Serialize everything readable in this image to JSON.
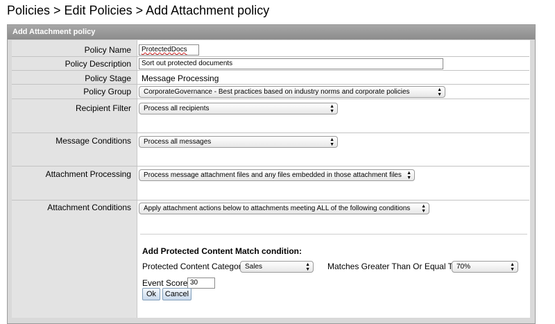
{
  "breadcrumb": "Policies > Edit Policies > Add Attachment policy",
  "panel": {
    "title": "Add Attachment policy"
  },
  "fields": {
    "policy_name": {
      "label": "Policy Name",
      "value": "ProtectedDocs"
    },
    "policy_description": {
      "label": "Policy Description",
      "value": "Sort out protected documents"
    },
    "policy_stage": {
      "label": "Policy Stage",
      "value": "Message Processing"
    },
    "policy_group": {
      "label": "Policy Group",
      "value": "CorporateGovernance - Best practices based on industry norms and corporate policies"
    },
    "recipient_filter": {
      "label": "Recipient Filter",
      "value": "Process all recipients"
    },
    "message_conditions": {
      "label": "Message Conditions",
      "value": "Process all messages"
    },
    "attachment_processing": {
      "label": "Attachment Processing",
      "value": "Process message attachment files and any files embedded in those attachment files"
    },
    "attachment_conditions": {
      "label": "Attachment Conditions",
      "value": "Apply attachment actions below to attachments meeting ALL of the following conditions"
    }
  },
  "condition": {
    "heading": "Add Protected Content Match condition:",
    "category_label": "Protected Content Category",
    "category_value": "Sales",
    "threshold_label": "Matches Greater Than Or Equal To",
    "threshold_value": "70%",
    "score_label": "Event Score:",
    "score_value": "30",
    "ok_label": "Ok",
    "cancel_label": "Cancel"
  },
  "icons": {
    "select_arrows": "updown-chevron-icon"
  }
}
